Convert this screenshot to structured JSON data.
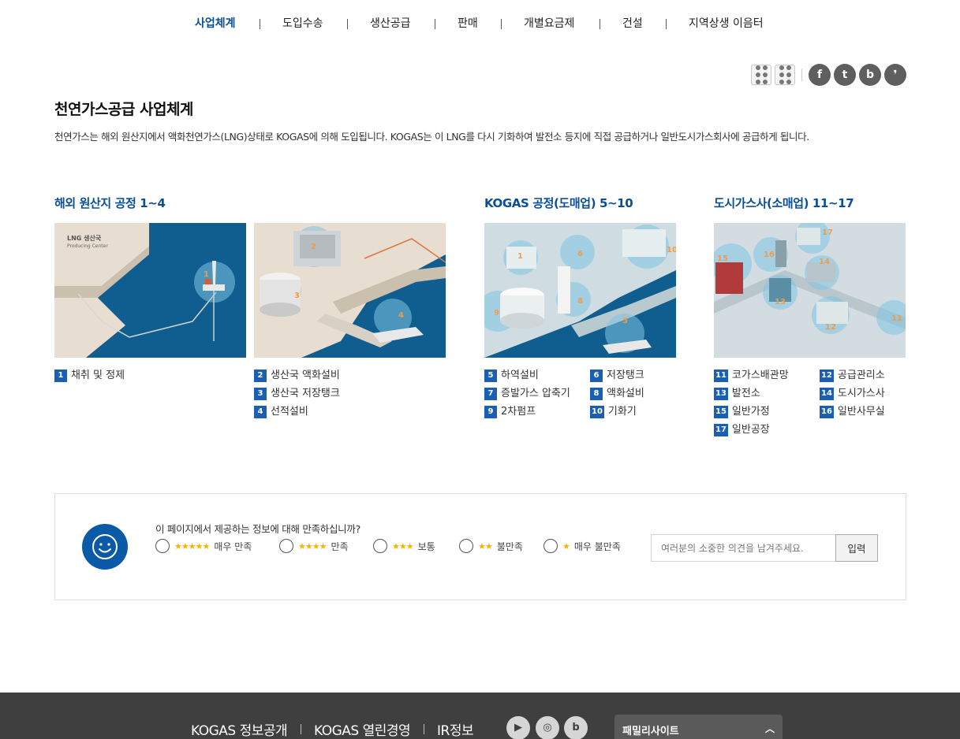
{
  "nav": {
    "items": [
      "사업체계",
      "도입수송",
      "생산공급",
      "판매",
      "개별요금제",
      "건설",
      "지역상생 이음터"
    ],
    "active_index": 0,
    "accent": "#0a4f96"
  },
  "share": {
    "icons": [
      "qr-code-icon",
      "qr-code-alt-icon",
      "facebook-icon",
      "twitter-icon",
      "blog-icon",
      "kakaostory-icon"
    ]
  },
  "page": {
    "title": "천연가스공급 사업체계",
    "intro": "천연가스는 해외 원산지에서 액화천연가스(LNG)상태로 KOGAS에 의해 도입됩니다. KOGAS는 이 LNG를 다시 기화하여 발전소 등지에 직접 공급하거나 일반도시가스회사에 공급하게 됩니다."
  },
  "stages": [
    {
      "title": "해외 원산지 공정 1~4",
      "map_label": "LNG 생산국",
      "map_sublabel": "Producing Center",
      "items_col1": [
        {
          "num": "1",
          "label": "채취 및 정제"
        }
      ],
      "items_col2": [
        {
          "num": "2",
          "label": "생산국 액화설비"
        },
        {
          "num": "3",
          "label": "생산국 저장탱크"
        },
        {
          "num": "4",
          "label": "선적설비"
        }
      ]
    },
    {
      "title": "KOGAS 공정(도매업) 5~10",
      "items_col1": [
        {
          "num": "5",
          "label": "하역설비"
        },
        {
          "num": "7",
          "label": "증발가스 압축기"
        },
        {
          "num": "9",
          "label": "2차펌프"
        }
      ],
      "items_col2": [
        {
          "num": "6",
          "label": "저장탱크"
        },
        {
          "num": "8",
          "label": "액화설비"
        },
        {
          "num": "10",
          "label": "기화기"
        }
      ]
    },
    {
      "title": "도시가스사(소매업) 11~17",
      "items_col1": [
        {
          "num": "11",
          "label": "코가스배관망"
        },
        {
          "num": "13",
          "label": "발전소"
        },
        {
          "num": "15",
          "label": "일반가정"
        },
        {
          "num": "17",
          "label": "일반공장"
        }
      ],
      "items_col2": [
        {
          "num": "12",
          "label": "공급관리소"
        },
        {
          "num": "14",
          "label": "도시가스사"
        },
        {
          "num": "16",
          "label": "일반사무실"
        }
      ]
    }
  ],
  "survey": {
    "question": "이 페이지에서 제공하는 정보에 대해 만족하십니까?",
    "options": [
      {
        "label": "매우 만족",
        "stars": "★★★★★"
      },
      {
        "label": "만족",
        "stars": "★★★★"
      },
      {
        "label": "보통",
        "stars": "★★★"
      },
      {
        "label": "불만족",
        "stars": "★★"
      },
      {
        "label": "매우 불만족",
        "stars": "★"
      }
    ],
    "placeholder": "여러분의 소중한 의견을 남겨주세요.",
    "submit_label": "입력"
  },
  "footer": {
    "links": [
      "KOGAS 정보공개",
      "KOGAS 열린경영",
      "IR정보"
    ],
    "sns_icons": [
      "youtube-icon",
      "instagram-icon",
      "blog-icon"
    ],
    "family_site_label": "패밀리사이트"
  }
}
